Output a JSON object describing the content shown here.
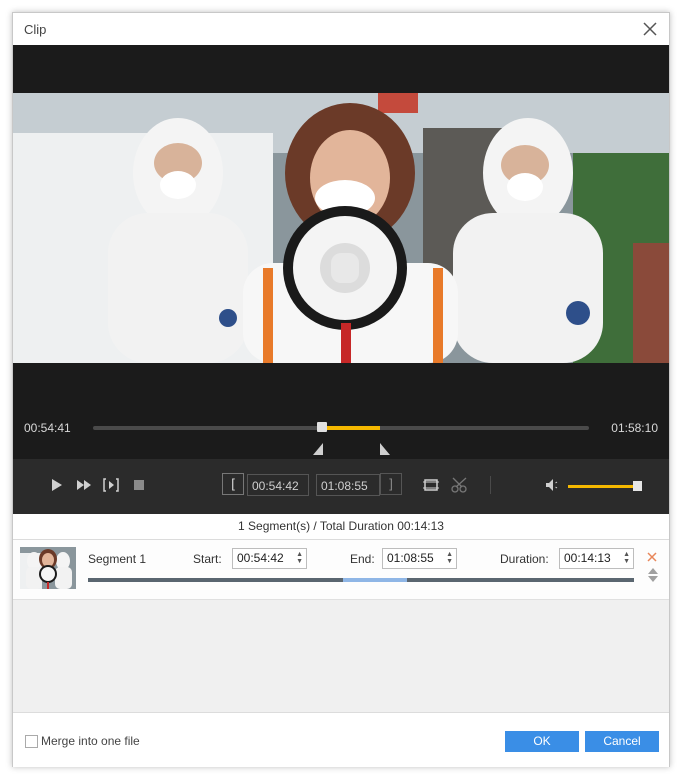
{
  "window": {
    "title": "Clip"
  },
  "player": {
    "current_time": "00:54:41",
    "total_time": "01:58:10",
    "selection_start_fraction": 0.4625,
    "selection_end_fraction": 0.5786
  },
  "controls": {
    "start_time": "00:54:42",
    "end_time": "01:08:55",
    "volume_fraction": 1.0,
    "start_bracket": "[",
    "end_bracket": "]"
  },
  "segments": {
    "summary": "1 Segment(s) / Total Duration 00:14:13",
    "items": [
      {
        "name": "Segment 1",
        "start_label": "Start:",
        "start": "00:54:42",
        "end_label": "End:",
        "end": "01:08:55",
        "duration_label": "Duration:",
        "duration": "00:14:13"
      }
    ]
  },
  "footer": {
    "merge_label": "Merge into one file",
    "merge_checked": false,
    "ok_label": "OK",
    "cancel_label": "Cancel"
  },
  "colors": {
    "accent": "#f5b800",
    "button": "#3a8ee6",
    "player_bg": "#1b1b1b",
    "controls_bg": "#2b2b2b"
  }
}
